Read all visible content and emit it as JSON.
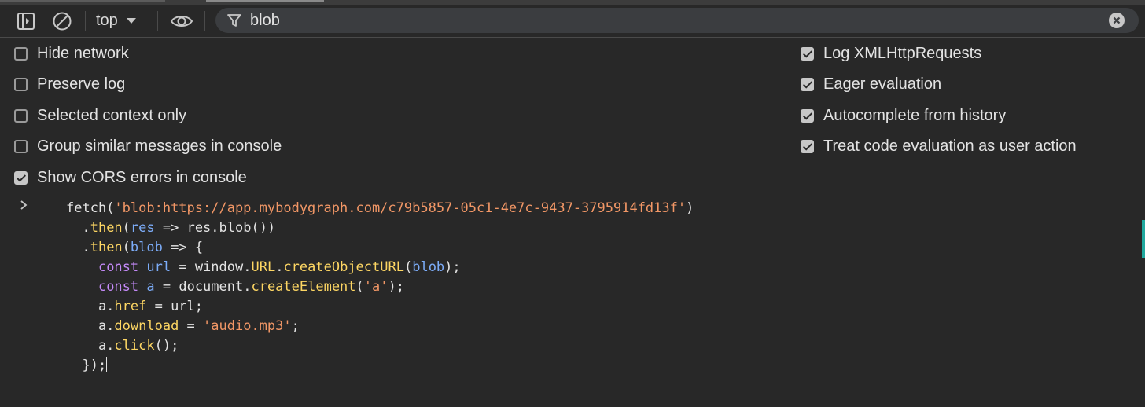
{
  "toolbar": {
    "context_label": "top",
    "filter_value": "blob",
    "icons": [
      "sidebar-toggle-icon",
      "clear-console-icon",
      "chevron-down-icon",
      "eye-icon",
      "filter-icon",
      "clear-filter-icon"
    ]
  },
  "settings": {
    "left": [
      {
        "label": "Hide network",
        "checked": false
      },
      {
        "label": "Preserve log",
        "checked": false
      },
      {
        "label": "Selected context only",
        "checked": false
      },
      {
        "label": "Group similar messages in console",
        "checked": false
      },
      {
        "label": "Show CORS errors in console",
        "checked": true
      }
    ],
    "right": [
      {
        "label": "Log XMLHttpRequests",
        "checked": true
      },
      {
        "label": "Eager evaluation",
        "checked": true
      },
      {
        "label": "Autocomplete from history",
        "checked": true
      },
      {
        "label": "Treat code evaluation as user action",
        "checked": true
      }
    ]
  },
  "console": {
    "prompt_glyph": ">",
    "code_lines": [
      "fetch('blob:https://app.mybodygraph.com/c79b5857-05c1-4e7c-9437-3795914fd13f')",
      "  .then(res => res.blob())",
      "  .then(blob => {",
      "    const url = window.URL.createObjectURL(blob);",
      "    const a = document.createElement('a');",
      "    a.href = url;",
      "    a.download = 'audio.mp3';",
      "    a.click();",
      "  });"
    ],
    "code_url": "blob:https://app.mybodygraph.com/c79b5857-05c1-4e7c-9437-3795914fd13f",
    "download_name": "audio.mp3",
    "tag_name": "a"
  },
  "colors": {
    "background": "#282828",
    "string": "#f29766",
    "keyword": "#c58af9",
    "variable": "#7cacf8",
    "property": "#fdd663",
    "accent_teal": "#21a99f"
  }
}
